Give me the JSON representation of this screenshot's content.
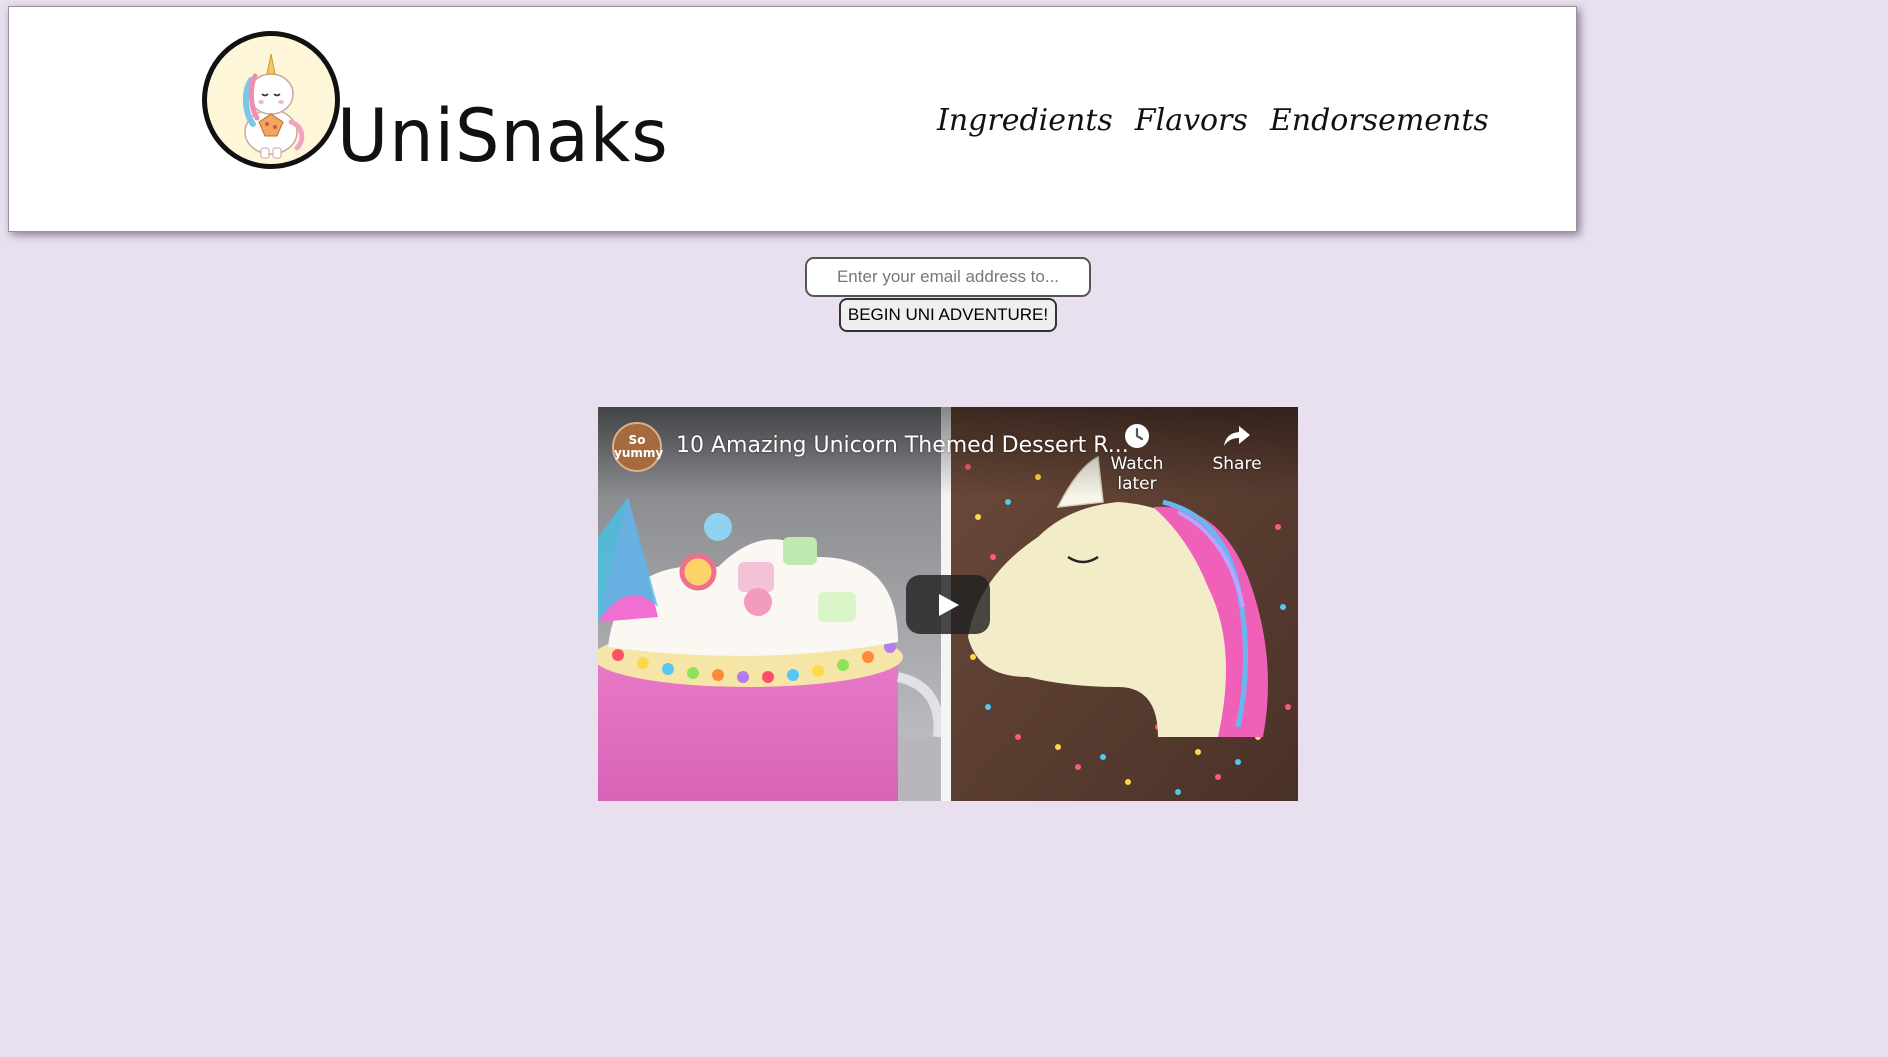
{
  "header": {
    "brand_name": "UniSnaks",
    "nav": [
      {
        "label": "Ingredients"
      },
      {
        "label": "Flavors"
      },
      {
        "label": "Endorsements"
      }
    ]
  },
  "signup": {
    "email_placeholder": "Enter your email address to...",
    "email_value": "",
    "button_label": "BEGIN UNI ADVENTURE!"
  },
  "video": {
    "channel_avatar_text": "So yummy",
    "title": "10 Amazing Unicorn Themed Dessert R...",
    "watch_later_label": "Watch later",
    "share_label": "Share",
    "icons": {
      "watch_later": "clock-icon",
      "share": "share-arrow-icon",
      "play": "play-icon"
    }
  },
  "colors": {
    "page_background": "#e9e0ef",
    "header_background": "#ffffff",
    "logo_background": "#fdf6d9"
  }
}
